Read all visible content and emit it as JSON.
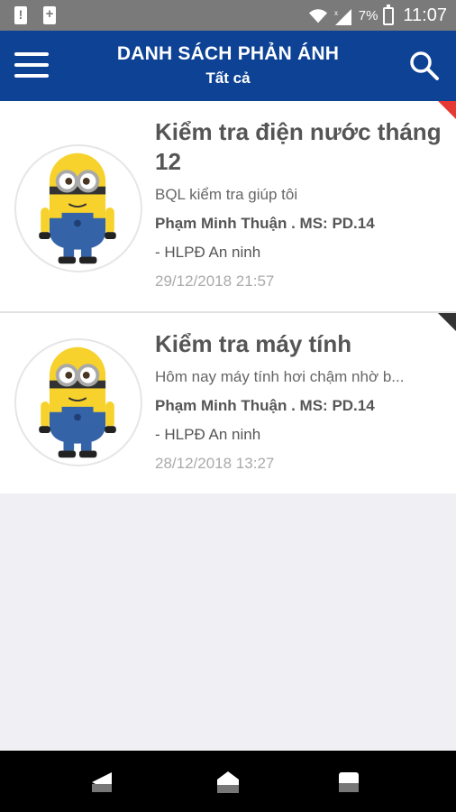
{
  "status_bar": {
    "battery_percent": "7%",
    "time": "11:07",
    "icons": [
      "alert-icon",
      "sim-icon",
      "wifi-icon",
      "signal-icon",
      "battery-icon"
    ]
  },
  "header": {
    "title": "DANH SÁCH PHẢN ÁNH",
    "subtitle": "Tất cả",
    "menu_icon": "hamburger-menu-icon",
    "search_icon": "search-icon",
    "background": "#0d4295"
  },
  "items": [
    {
      "title": "Kiểm tra điện nước tháng 12",
      "description": "BQL kiểm tra giúp tôi",
      "author": "Phạm Minh Thuận . MS: PD.14",
      "department": " - HLPĐ An ninh",
      "date": "29/12/2018 21:57",
      "corner_color": "#e53935"
    },
    {
      "title": "Kiểm tra máy tính",
      "description": "Hôm nay máy tính hơi chậm nhờ b...",
      "author": "Phạm Minh Thuận . MS: PD.14",
      "department": " - HLPĐ An ninh",
      "date": "28/12/2018 13:27",
      "corner_color": "#333333"
    }
  ],
  "nav_bar": {
    "icons": [
      "back-icon",
      "home-icon",
      "recent-apps-icon"
    ]
  }
}
